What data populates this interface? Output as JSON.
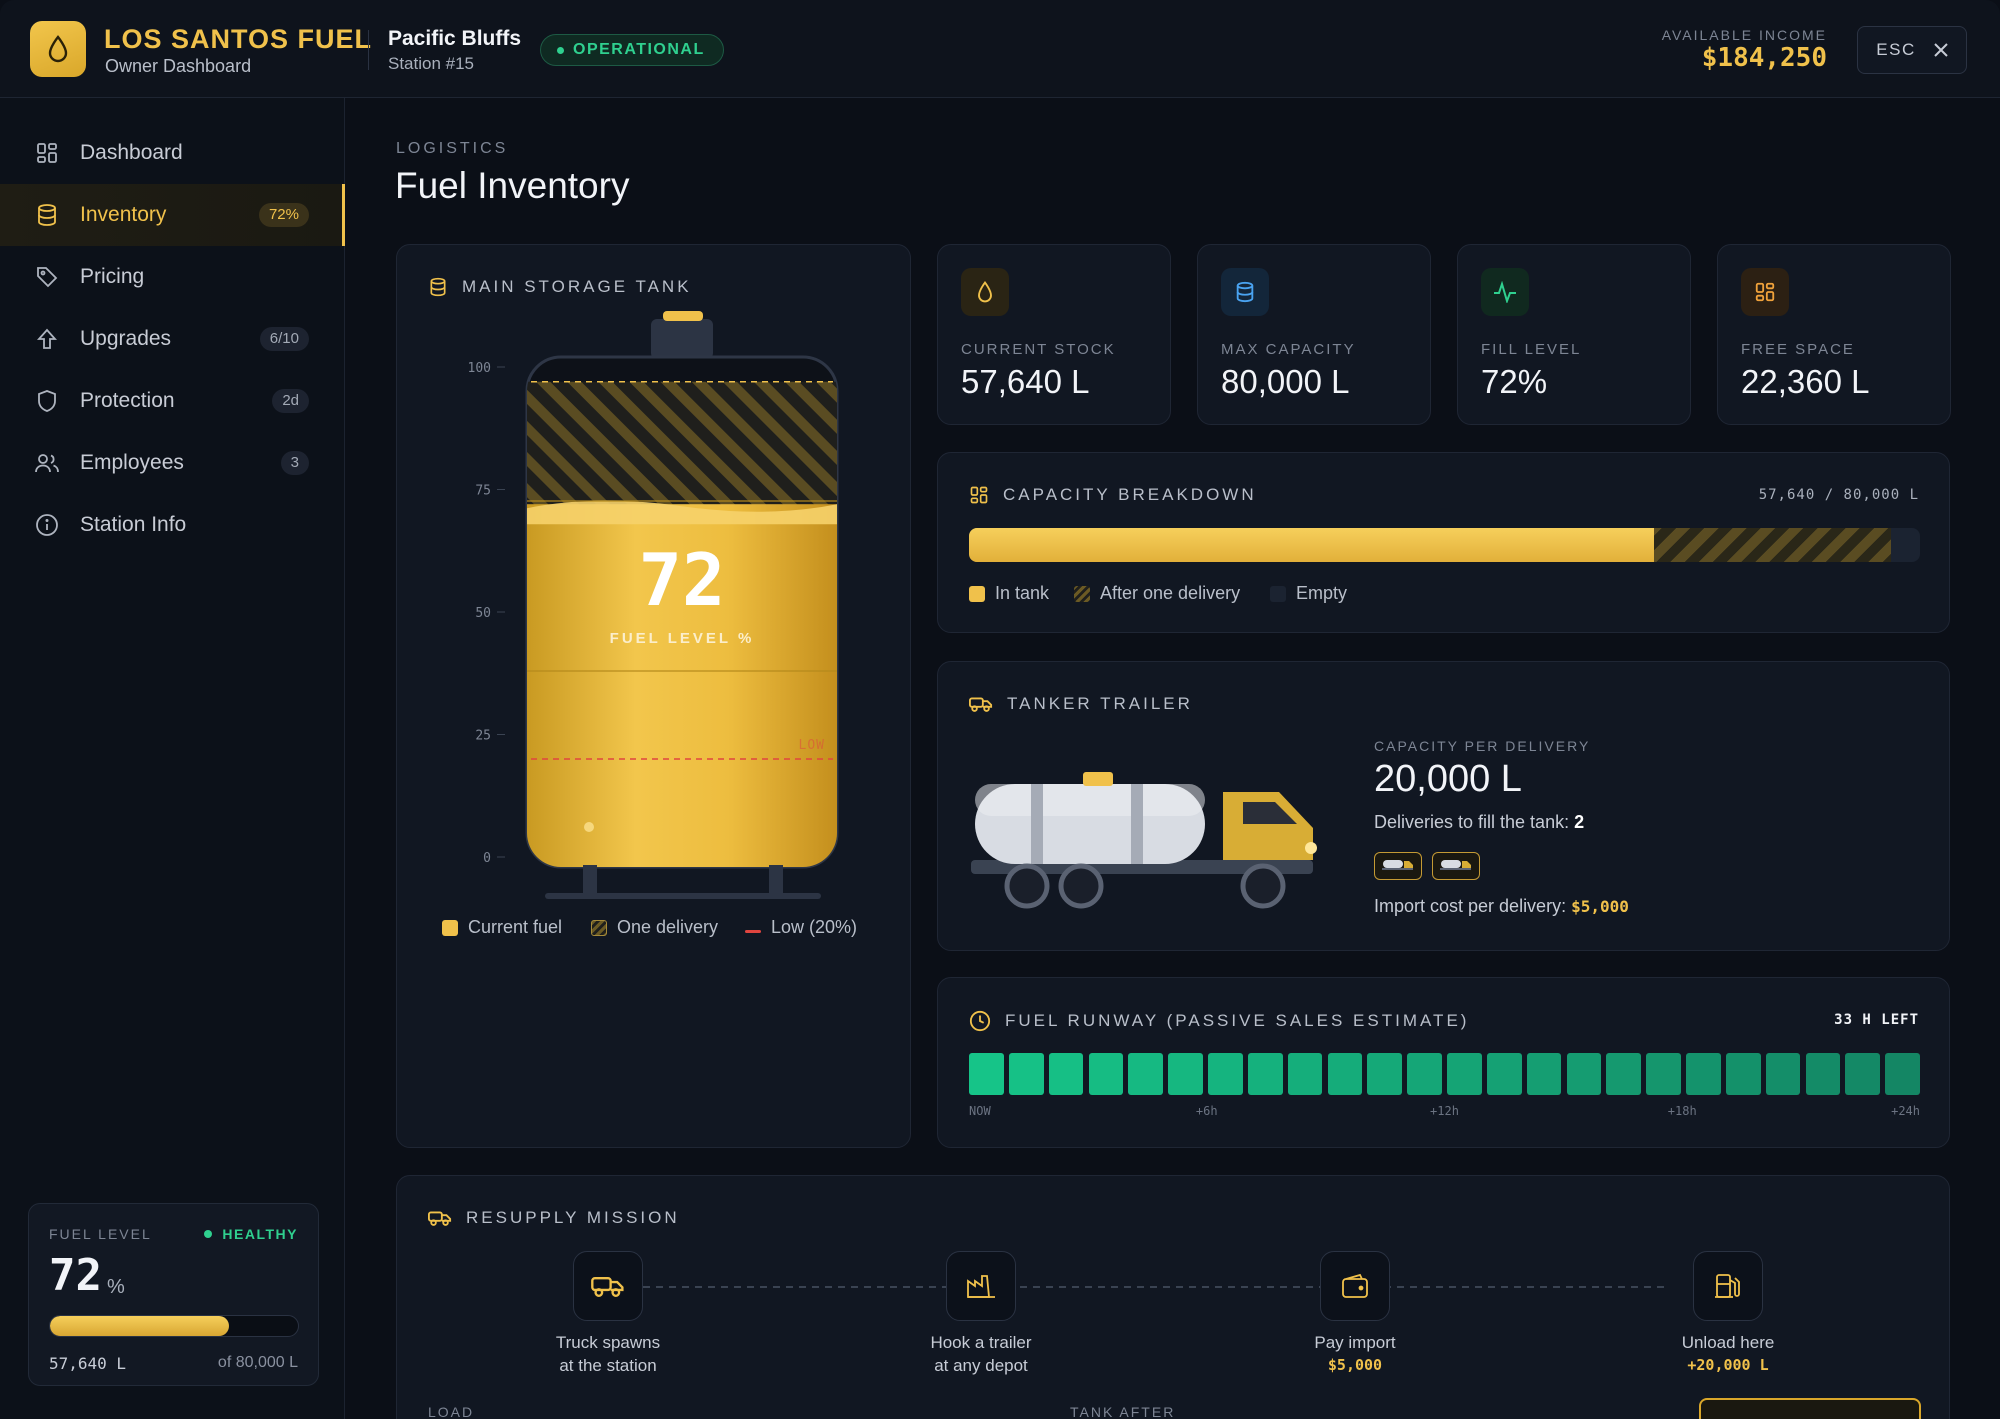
{
  "header": {
    "brand": "LOS SANTOS FUEL",
    "subtitle": "Owner Dashboard",
    "station_name": "Pacific Bluffs",
    "station_number": "Station #15",
    "status": "OPERATIONAL",
    "income_label": "AVAILABLE INCOME",
    "income_value": "$184,250",
    "esc_label": "ESC"
  },
  "sidebar": {
    "items": [
      {
        "label": "Dashboard",
        "icon": "grid-icon",
        "badge": ""
      },
      {
        "label": "Inventory",
        "icon": "database-icon",
        "badge": "72%",
        "active": true
      },
      {
        "label": "Pricing",
        "icon": "tag-icon",
        "badge": ""
      },
      {
        "label": "Upgrades",
        "icon": "arrow-up-icon",
        "badge": "6/10"
      },
      {
        "label": "Protection",
        "icon": "shield-icon",
        "badge": "2d"
      },
      {
        "label": "Employees",
        "icon": "users-icon",
        "badge": "3"
      },
      {
        "label": "Station Info",
        "icon": "info-icon",
        "badge": ""
      }
    ],
    "fuel_card": {
      "label": "FUEL LEVEL",
      "status": "HEALTHY",
      "value": "72",
      "unit": "%",
      "fill_percent": 72,
      "stock": "57,640 L",
      "of_capacity": "of 80,000 L"
    }
  },
  "main": {
    "kicker": "LOGISTICS",
    "title": "Fuel Inventory"
  },
  "tank": {
    "title": "MAIN STORAGE TANK",
    "axis_ticks": [
      "100",
      "75",
      "50",
      "25",
      "0"
    ],
    "level_value": "72",
    "level_caption": "FUEL LEVEL %",
    "fill_percent": 72,
    "after_delivery_percent": 97,
    "low_percent": 20,
    "low_label": "LOW",
    "legend": [
      {
        "label": "Current fuel",
        "color": "#f0c14b"
      },
      {
        "label": "One delivery",
        "color": "#6b5a24"
      },
      {
        "label": "Low (20%)",
        "color": "#e0453f"
      }
    ]
  },
  "stats": [
    {
      "label": "CURRENT STOCK",
      "value": "57,640 L",
      "icon": "droplet-icon",
      "color": "#f0c14b"
    },
    {
      "label": "MAX CAPACITY",
      "value": "80,000 L",
      "icon": "database-icon",
      "color": "#4aa3f0"
    },
    {
      "label": "FILL LEVEL",
      "value": "72%",
      "icon": "activity-icon",
      "color": "#2fd08f"
    },
    {
      "label": "FREE SPACE",
      "value": "22,360 L",
      "icon": "grid-icon",
      "color": "#f0a23b"
    }
  ],
  "capacity": {
    "title": "CAPACITY BREAKDOWN",
    "summary": "57,640 / 80,000 L",
    "in_tank_percent": 72,
    "after_delivery_percent": 97,
    "legend": [
      "In tank",
      "After one delivery",
      "Empty"
    ]
  },
  "trailer": {
    "title": "TANKER TRAILER",
    "cap_label": "CAPACITY PER DELIVERY",
    "cap_value": "20,000 L",
    "deliveries_text": "Deliveries to fill the tank:",
    "deliveries_count": "2",
    "import_label": "Import cost per delivery:",
    "import_value": "$5,000"
  },
  "runway": {
    "title": "FUEL RUNWAY (PASSIVE SALES ESTIMATE)",
    "remaining": "33 H LEFT",
    "segments": 24,
    "ticks": [
      "NOW",
      "+6h",
      "+12h",
      "+18h",
      "+24h"
    ]
  },
  "resupply": {
    "title": "RESUPPLY MISSION",
    "steps": [
      {
        "line1": "Truck spawns",
        "line2": "at the station",
        "icon": "truck-icon"
      },
      {
        "line1": "Hook a trailer",
        "line2": "at any depot",
        "icon": "factory-icon"
      },
      {
        "line1": "Pay import",
        "line2": "$5,000",
        "icon": "wallet-icon"
      },
      {
        "line1": "Unload here",
        "line2": "+20,000 L",
        "icon": "fuel-pump-icon"
      }
    ],
    "footer_left": "LOAD",
    "footer_mid": "TANK AFTER"
  },
  "colors": {
    "accent": "#f0c14b",
    "success": "#2fd08f",
    "background": "#0b0f17",
    "panel": "#111722"
  }
}
